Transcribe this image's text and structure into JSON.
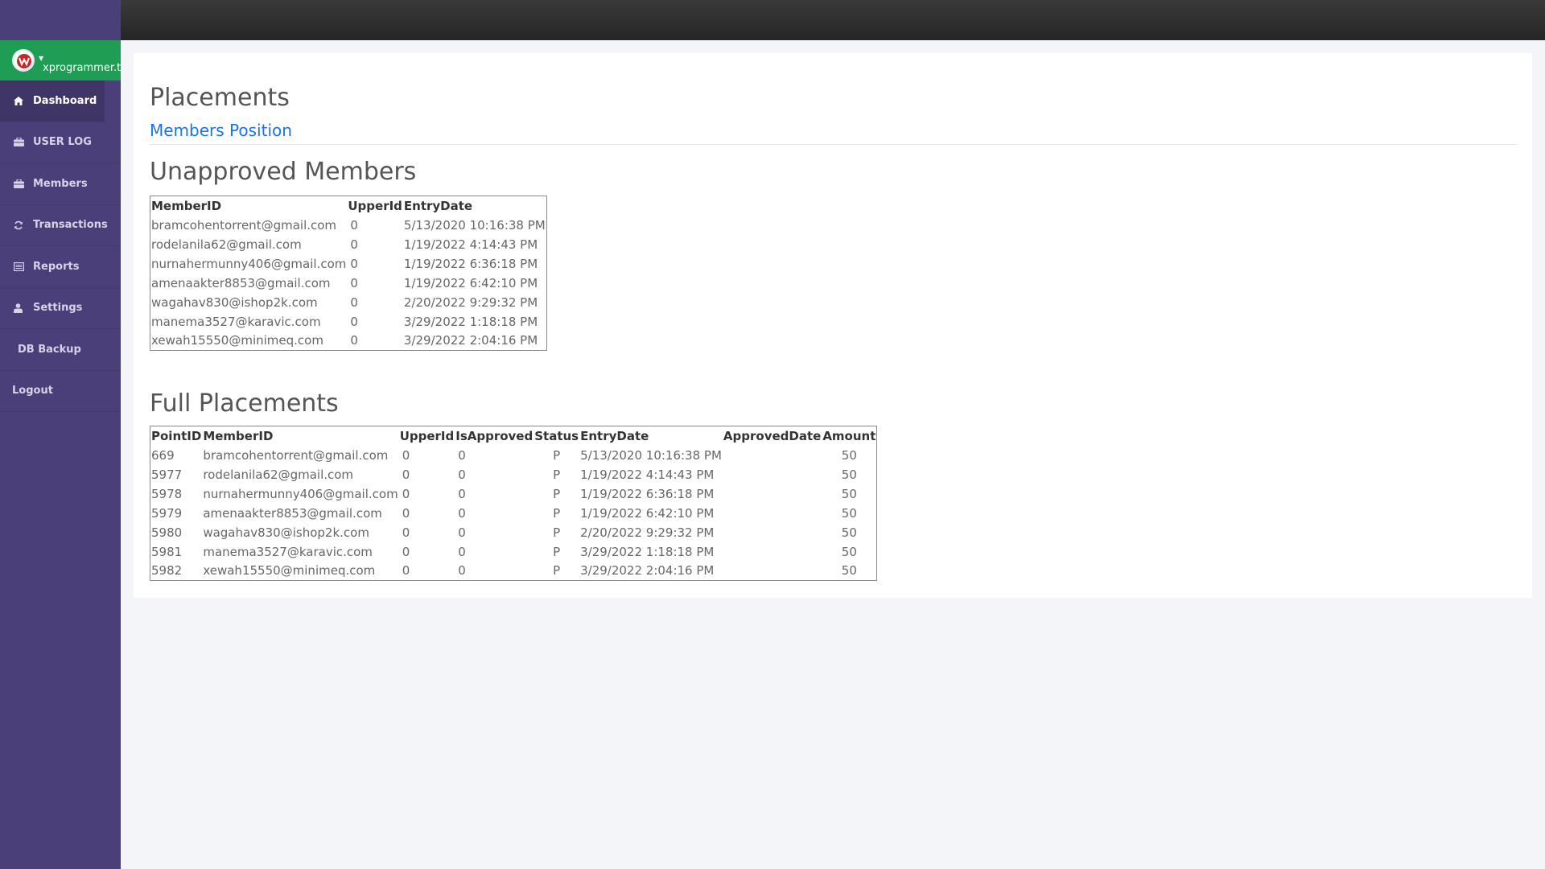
{
  "sidebar": {
    "username": "xprogrammer.tech",
    "items": [
      {
        "label": "Dashboard",
        "icon": "home-icon",
        "active": true
      },
      {
        "label": "USER LOG",
        "icon": "briefcase-icon"
      },
      {
        "label": "Members",
        "icon": "briefcase-icon"
      },
      {
        "label": "Transactions",
        "icon": "refresh-icon"
      },
      {
        "label": "Reports",
        "icon": "list-icon"
      },
      {
        "label": "Settings",
        "icon": "user-icon"
      },
      {
        "label": "DB Backup",
        "icon": ""
      },
      {
        "label": "Logout",
        "icon": ""
      }
    ]
  },
  "main": {
    "title": "Placements",
    "link": "Members Position",
    "unapproved": {
      "heading": "Unapproved  Members",
      "columns": [
        "MemberID",
        "UpperId",
        "EntryDate"
      ],
      "rows": [
        [
          "bramcohentorrent@gmail.com",
          "0",
          "5/13/2020 10:16:38 PM"
        ],
        [
          "rodelanila62@gmail.com",
          "0",
          "1/19/2022 4:14:43 PM"
        ],
        [
          "nurnahermunny406@gmail.com",
          "0",
          "1/19/2022 6:36:18 PM"
        ],
        [
          "amenaakter8853@gmail.com",
          "0",
          "1/19/2022 6:42:10 PM"
        ],
        [
          "wagahav830@ishop2k.com",
          "0",
          "2/20/2022 9:29:32 PM"
        ],
        [
          "manema3527@karavic.com",
          "0",
          "3/29/2022 1:18:18 PM"
        ],
        [
          "xewah15550@minimeq.com",
          "0",
          "3/29/2022 2:04:16 PM"
        ]
      ]
    },
    "full": {
      "heading": "Full Placements",
      "columns": [
        "PointID",
        "MemberID",
        "UpperId",
        "IsApproved",
        "Status",
        "EntryDate",
        "ApprovedDate",
        "Amount"
      ],
      "rows": [
        [
          "669",
          "bramcohentorrent@gmail.com",
          "0",
          "0",
          "P",
          "5/13/2020 10:16:38 PM",
          "",
          "50"
        ],
        [
          "5977",
          "rodelanila62@gmail.com",
          "0",
          "0",
          "P",
          "1/19/2022 4:14:43 PM",
          "",
          "50"
        ],
        [
          "5978",
          "nurnahermunny406@gmail.com",
          "0",
          "0",
          "P",
          "1/19/2022 6:36:18 PM",
          "",
          "50"
        ],
        [
          "5979",
          "amenaakter8853@gmail.com",
          "0",
          "0",
          "P",
          "1/19/2022 6:42:10 PM",
          "",
          "50"
        ],
        [
          "5980",
          "wagahav830@ishop2k.com",
          "0",
          "0",
          "P",
          "2/20/2022 9:29:32 PM",
          "",
          "50"
        ],
        [
          "5981",
          "manema3527@karavic.com",
          "0",
          "0",
          "P",
          "3/29/2022 1:18:18 PM",
          "",
          "50"
        ],
        [
          "5982",
          "xewah15550@minimeq.com",
          "0",
          "0",
          "P",
          "3/29/2022 2:04:16 PM",
          "",
          "50"
        ]
      ]
    }
  },
  "colors": {
    "sidebar": "#4a3f78",
    "profile": "#1f9d55",
    "topbar": "#2e2e2e",
    "link": "#1a73e8"
  }
}
